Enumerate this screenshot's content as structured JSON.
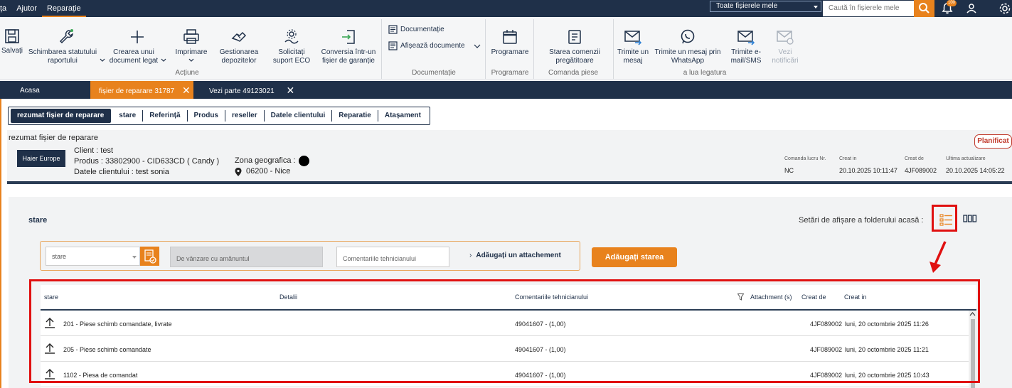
{
  "topbar": {
    "menu": [
      {
        "label": "ța",
        "active": false
      },
      {
        "label": "Ajutor",
        "active": false
      },
      {
        "label": "Reparație",
        "active": true
      }
    ],
    "folder_select": "Toate fișierele mele",
    "search_placeholder": "Caută în fișierele mele",
    "notifications_count": "100"
  },
  "ribbon": {
    "buttons": {
      "save": "Salvați",
      "change_status": "Schimbarea statutului raportului",
      "create_doc": "Crearea unui document legat",
      "print": "Imprimare",
      "deposits": "Gestionarea depozitelor",
      "eco": "Solicitați suport ECO",
      "convert": "Conversia într-un fișier de garanție",
      "documentation": "Documentație",
      "show_docs": "Afișează documente",
      "scheduling": "Programare",
      "order_status": "Starea comenzii pregătitoare",
      "send_msg": "Trimite un mesaj",
      "whatsapp": "Trimite un mesaj prin WhatsApp",
      "email": "Trimite e-mail/SMS",
      "notifications": "Vezi notificări"
    },
    "groups": {
      "actions": "Acțiune",
      "documentation": "Documentație",
      "scheduling": "Programare",
      "parts_order": "Comanda piese",
      "contact": "a lua legatura"
    }
  },
  "tabs": [
    {
      "label": "Acasa",
      "active": false,
      "closable": false
    },
    {
      "label": "fișier de reparare 31787",
      "active": true,
      "closable": true
    },
    {
      "label": "Vezi parte 49123021",
      "active": false,
      "closable": true
    }
  ],
  "segments": [
    "rezumat fișier de reparare",
    "stare",
    "Referință",
    "Produs",
    "reseller",
    "Datele clientului",
    "Reparatie",
    "Atașament"
  ],
  "summary": {
    "title": "rezumat fișier de reparare",
    "logo": "Haier Europe",
    "client": "Client : test",
    "product": "Produs : 33802900  -  CID633CD ( Candy )",
    "client_data": "Datele clientului : test sonia",
    "zone_label": "Zona geografica :",
    "location": "06200  -  Nice",
    "status_badge": "Planificat",
    "meta": [
      {
        "label": "Comanda lucru Nr.",
        "value": "NC"
      },
      {
        "label": "Creat in",
        "value": "20.10.2025 10:11:47"
      },
      {
        "label": "Creat de",
        "value": "4JF089002"
      },
      {
        "label": "Ultima actualizare",
        "value": "20.10.2025 14:05:22"
      }
    ]
  },
  "stare": {
    "title": "stare",
    "display_settings": "Setări de afișare a folderului acasă :",
    "select_value": "stare",
    "sales_placeholder": "De vânzare cu amănuntul",
    "comment_placeholder": "Comentariile tehnicianului",
    "attach_label": "Adăugați un attachement",
    "add_button": "Adăugați starea",
    "columns": [
      "stare",
      "Detalii",
      "Comentariile tehnicianului",
      "Attachment (s)",
      "Creat de",
      "Creat in"
    ],
    "rows": [
      {
        "stare": "201 - Piese schimb comandate, livrate",
        "detalii": "",
        "comment": "49041607 - (1,00)",
        "created_by": "4JF089002",
        "created_in": "luni, 20 octombrie 2025 11:26"
      },
      {
        "stare": "205 - Piese schimb comandate",
        "detalii": "",
        "comment": "49041607 - (1,00)",
        "created_by": "4JF089002",
        "created_in": "luni, 20 octombrie 2025 11:21"
      },
      {
        "stare": "1102 - Piesa de comandat",
        "detalii": "",
        "comment": "49041607 - (1,00)",
        "created_by": "4JF089002",
        "created_in": "luni, 20 octombrie 2025 10:43"
      }
    ]
  },
  "colors": {
    "navy": "#1f3049",
    "accent": "#e8821d",
    "annotation": "#e01010",
    "badge_border": "#c0392b"
  }
}
